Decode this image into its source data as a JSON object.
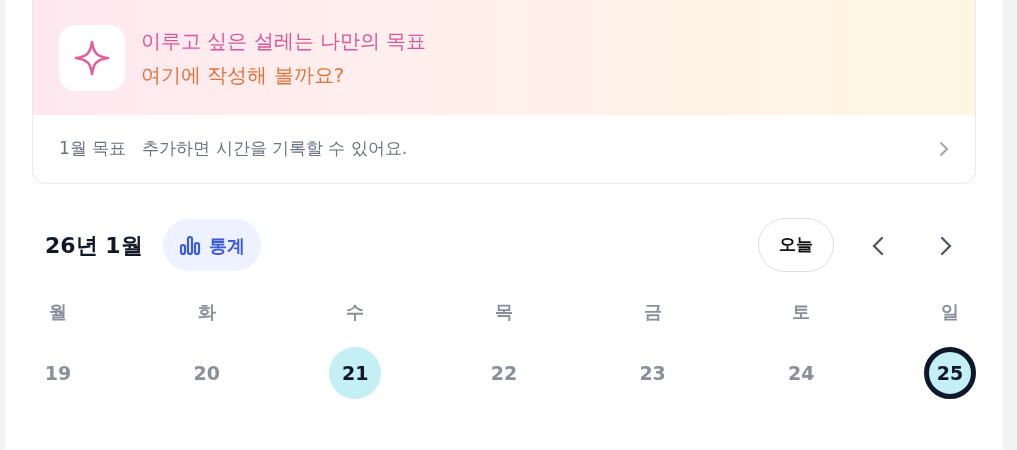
{
  "goal_banner": {
    "line_1": "이루고 싶은 설레는 나만의 목표",
    "line_2": "여기에 작성해 볼까요?",
    "month_goal_label": "1월 목표",
    "month_goal_hint": "추가하면 시간을 기록할 수 있어요."
  },
  "calendar": {
    "title": "26년 1월",
    "stats_button": "통계",
    "today_button": "오늘",
    "weekdays": [
      "월",
      "화",
      "수",
      "목",
      "금",
      "토",
      "일"
    ],
    "days": [
      {
        "label": "19",
        "highlighted": false,
        "selected": false
      },
      {
        "label": "20",
        "highlighted": false,
        "selected": false
      },
      {
        "label": "21",
        "highlighted": true,
        "selected": false
      },
      {
        "label": "22",
        "highlighted": false,
        "selected": false
      },
      {
        "label": "23",
        "highlighted": false,
        "selected": false
      },
      {
        "label": "24",
        "highlighted": false,
        "selected": false
      },
      {
        "label": "25",
        "highlighted": true,
        "selected": true
      }
    ]
  }
}
